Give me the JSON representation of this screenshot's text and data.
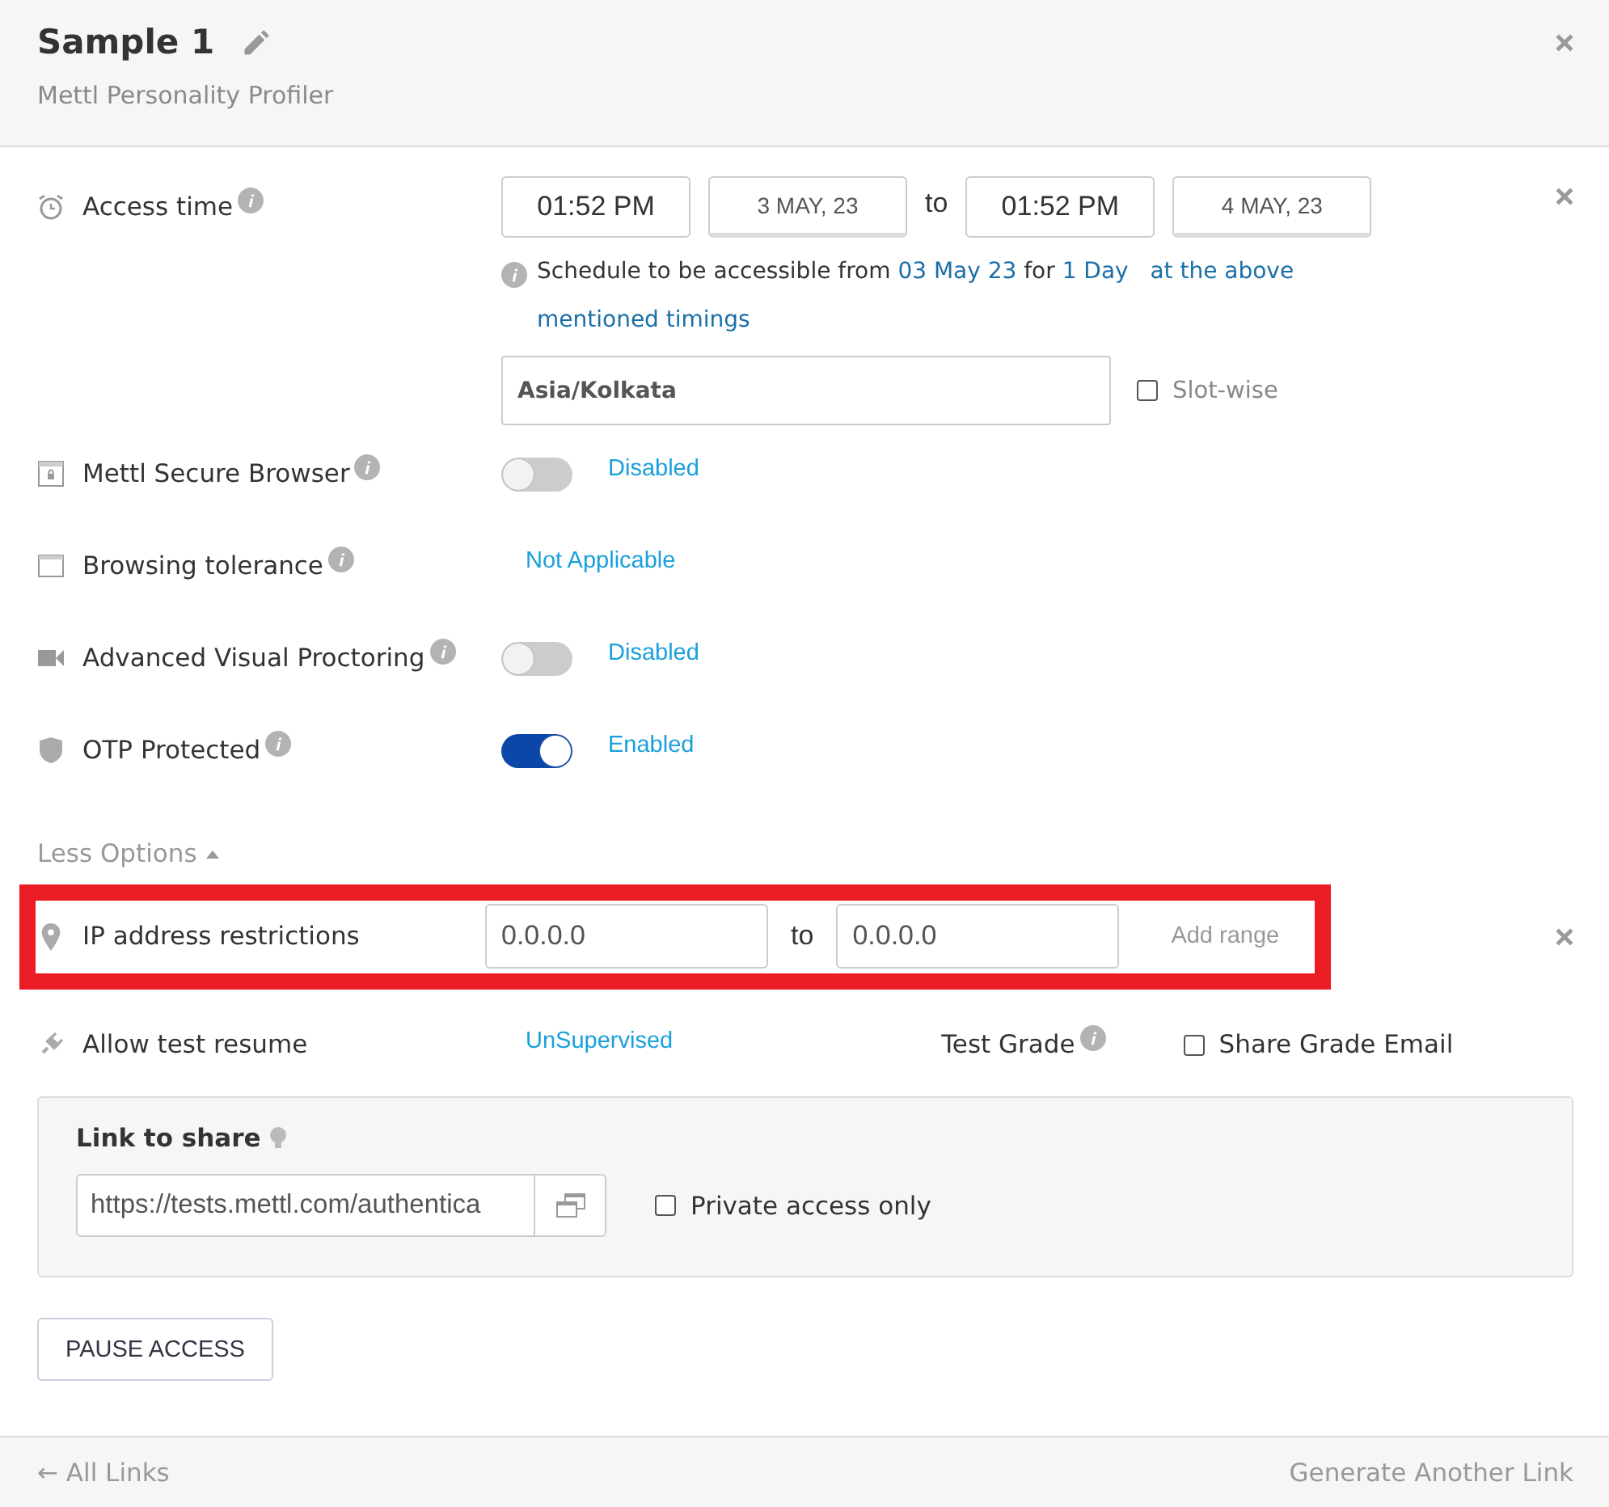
{
  "header": {
    "title": "Sample 1",
    "subtitle": "Mettl Personality Profiler"
  },
  "access_time": {
    "label": "Access time",
    "start_time": "01:52 PM",
    "start_date": "3 MAY, 23",
    "to": "to",
    "end_time": "01:52 PM",
    "end_date": "4 MAY, 23",
    "note": [
      {
        "text": "Schedule to be accessible from ",
        "highlight": false
      },
      {
        "text": "03 May 23",
        "highlight": true
      },
      {
        "text": " for ",
        "highlight": false
      },
      {
        "text": "1 Day",
        "highlight": true
      },
      {
        "text": "   at the above mentioned timings",
        "highlight": true
      }
    ],
    "timezone": "Asia/Kolkata",
    "slot_wise": {
      "label": "Slot-wise",
      "checked": false
    }
  },
  "settings": [
    {
      "kind": "toggle",
      "label": "Mettl Secure Browser",
      "on": false,
      "status": "Disabled"
    },
    {
      "kind": "text",
      "label": "Browsing tolerance",
      "status": "Not Applicable"
    },
    {
      "kind": "toggle",
      "label": "Advanced Visual Proctoring",
      "on": false,
      "status": "Disabled"
    },
    {
      "kind": "toggle",
      "label": "OTP Protected",
      "on": true,
      "status": "Enabled"
    }
  ],
  "less_options": "Less Options",
  "ip": {
    "label": "IP address restrictions",
    "from": "0.0.0.0",
    "to_word": "to",
    "to": "0.0.0.0",
    "add_range": "Add range",
    "highlighted": true
  },
  "resume": {
    "label": "Allow test resume",
    "value": "UnSupervised",
    "test_grade": "Test Grade",
    "share_grade_email": {
      "label": "Share Grade Email",
      "checked": false
    }
  },
  "link_card": {
    "title": "Link to share",
    "url": "https://tests.mettl.com/authentica",
    "private_access": {
      "label": "Private access only",
      "checked": false
    }
  },
  "pause_button": "PAUSE ACCESS",
  "footer": {
    "back": "← All Links",
    "generate": "Generate Another Link"
  }
}
